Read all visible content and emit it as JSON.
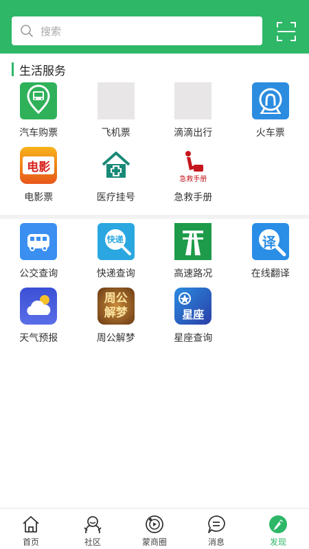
{
  "search": {
    "placeholder": "搜索"
  },
  "section": {
    "title": "生活服务"
  },
  "services_1": [
    {
      "label": "汽车购票",
      "icon": "bus-ticket-icon",
      "color": "#2fb15a"
    },
    {
      "label": "飞机票",
      "icon": "plane-ticket-icon",
      "color": "#e8e6e6"
    },
    {
      "label": "滴滴出行",
      "icon": "didi-icon",
      "color": "#e8e6e6"
    },
    {
      "label": "火车票",
      "icon": "train-ticket-icon",
      "color": "#2c8ce0"
    },
    {
      "label": "电影票",
      "icon": "movie-ticket-icon",
      "color": "#f08c1a",
      "text": "电影"
    },
    {
      "label": "医疗挂号",
      "icon": "hospital-icon",
      "color": "#ffffff"
    },
    {
      "label": "急救手册",
      "icon": "first-aid-icon",
      "color": "#ffffff",
      "text": "急救手册"
    }
  ],
  "services_2": [
    {
      "label": "公交查询",
      "icon": "bus-query-icon",
      "color": "#3a8ff0"
    },
    {
      "label": "快递查询",
      "icon": "express-query-icon",
      "color": "#2aa7e0",
      "text": "快递"
    },
    {
      "label": "高速路况",
      "icon": "highway-icon",
      "color": "#1e9b4a"
    },
    {
      "label": "在线翻译",
      "icon": "translate-icon",
      "color": "#2a8de6",
      "text": "译"
    },
    {
      "label": "天气预报",
      "icon": "weather-icon",
      "color": "#3f55d8"
    },
    {
      "label": "周公解梦",
      "icon": "dream-icon",
      "color": "#8a4a1e",
      "text": "周公解梦"
    },
    {
      "label": "星座查询",
      "icon": "horoscope-icon",
      "color": "#2f4fb8",
      "text": "星座"
    }
  ],
  "tabs": [
    {
      "label": "首页",
      "icon": "home-icon"
    },
    {
      "label": "社区",
      "icon": "community-icon"
    },
    {
      "label": "蒙商圈",
      "icon": "business-circle-icon"
    },
    {
      "label": "消息",
      "icon": "message-icon"
    },
    {
      "label": "发现",
      "icon": "discover-icon",
      "active": true
    }
  ],
  "colors": {
    "brand": "#2db767",
    "text": "#333333"
  }
}
